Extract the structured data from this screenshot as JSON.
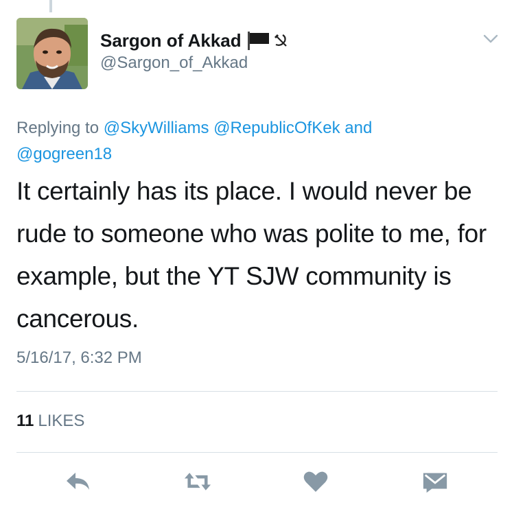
{
  "author": {
    "display_name": "Sargon of Akkad",
    "handle": "@Sargon_of_Akkad",
    "badges": [
      "black-flag-icon",
      "hammer-and-sickle-icon"
    ]
  },
  "reply_context": {
    "prefix": "Replying to",
    "mention_1": "@SkyWilliams",
    "mention_2": "@RepublicOfKek",
    "and": "and",
    "mention_3": "@gogreen18"
  },
  "tweet": {
    "text": "It certainly has its place. I would never be rude to someone who was polite to me, for example, but the YT SJW community is cancerous.",
    "timestamp": "5/16/17, 6:32 PM"
  },
  "stats": {
    "likes_count": "11",
    "likes_label": "LIKES"
  },
  "actions": {
    "reply_icon": "reply-icon",
    "retweet_icon": "retweet-icon",
    "like_icon": "heart-icon",
    "dm_icon": "envelope-icon"
  },
  "colors": {
    "text": "#14171a",
    "secondary": "#657786",
    "link": "#1b95e0",
    "icon": "#8899a6",
    "divider": "#d7dfe5"
  }
}
